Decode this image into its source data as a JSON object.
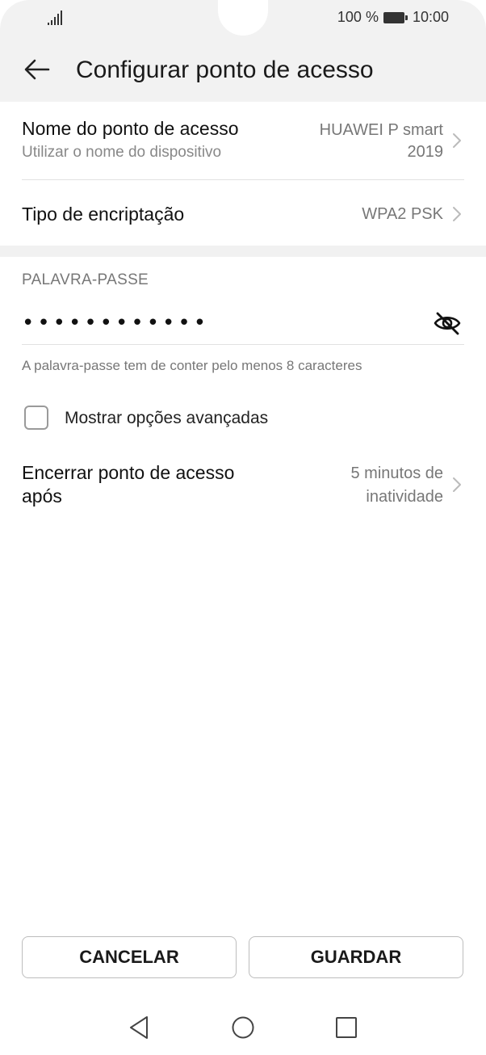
{
  "status_bar": {
    "signal_icon": "signal-bars-icon",
    "battery_percent": "100 %",
    "battery_icon": "battery-full-icon",
    "time": "10:00"
  },
  "header": {
    "back_icon": "arrow-left-icon",
    "title": "Configurar ponto de acesso"
  },
  "hotspot_name": {
    "label": "Nome do ponto de acesso",
    "sub": "Utilizar o nome do dispositivo",
    "value_line1": "HUAWEI P smart",
    "value_line2": "2019"
  },
  "encryption": {
    "label": "Tipo de encriptação",
    "value": "WPA2 PSK"
  },
  "password": {
    "section_header": "PALAVRA-PASSE",
    "masked_value": "••••••••••••",
    "visibility_icon": "eye-slash-icon",
    "hint": "A palavra-passe tem de conter pelo menos 8 caracteres"
  },
  "advanced": {
    "label": "Mostrar opções avançadas",
    "checked": false
  },
  "auto_off": {
    "label_line1": "Encerrar ponto de acesso",
    "label_line2": "após",
    "value_line1": "5 minutos de",
    "value_line2": "inatividade"
  },
  "buttons": {
    "cancel": "CANCELAR",
    "save": "GUARDAR"
  },
  "nav_bar": {
    "back_icon": "triangle-back-icon",
    "home_icon": "circle-home-icon",
    "recents_icon": "square-recents-icon"
  },
  "colors": {
    "header_bg": "#f2f2f2",
    "text_primary": "#111111",
    "text_secondary": "#888888"
  }
}
